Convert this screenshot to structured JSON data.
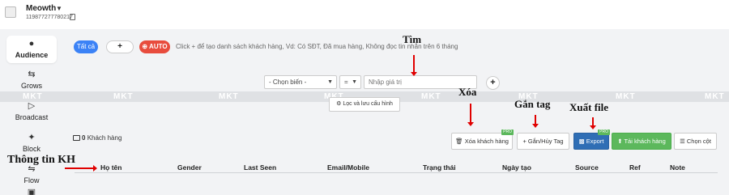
{
  "account": {
    "name": "Meowth",
    "id": "119877277780217"
  },
  "sidebar": {
    "items": [
      {
        "label": "Audience",
        "icon": "user-icon"
      },
      {
        "label": "Grows",
        "icon": "arrows-icon"
      },
      {
        "label": "Broadcast",
        "icon": "send-icon"
      },
      {
        "label": "Block",
        "icon": "block-icon"
      },
      {
        "label": "Flow",
        "icon": "flow-icon"
      }
    ]
  },
  "filters": {
    "all_label": "Tất cả",
    "add_label": "+",
    "auto_label": "AUTO",
    "hint": "Click + để tạo danh sách khách hàng, Vd: Có SĐT, Đã mua hàng, Không đọc tin nhắn trên 6 tháng"
  },
  "condition": {
    "field_placeholder": "- Chọn biến -",
    "operator": "=",
    "value_placeholder": "Nhập giá trị",
    "add_label": "+",
    "save_label": "Lọc và lưu cấu hình"
  },
  "watermark": "MKT",
  "customers": {
    "count": "0",
    "label": "Khách hàng"
  },
  "toolbar": {
    "delete_label": "Xóa khách hàng",
    "tag_label": "Gắn/Hủy Tag",
    "export_label": "Export",
    "upload_label": "Tải khách hàng",
    "columns_label": "Chọn cột",
    "pro_badge": "PRO"
  },
  "table": {
    "columns": [
      "Họ tên",
      "Gender",
      "Last Seen",
      "Email/Mobile",
      "Trạng thái",
      "Ngày tạo",
      "Source",
      "Ref",
      "Note"
    ]
  },
  "annotations": {
    "search": "Tìm",
    "delete": "Xóa",
    "tag": "Gắn tag",
    "export": "Xuất file",
    "info": "Thông tin KH"
  },
  "colors": {
    "accent": "#3b82f6",
    "auto": "#e84c3d",
    "export": "#2f6eb5",
    "upload": "#5cb85c",
    "annotation_arrow": "#e00000"
  }
}
